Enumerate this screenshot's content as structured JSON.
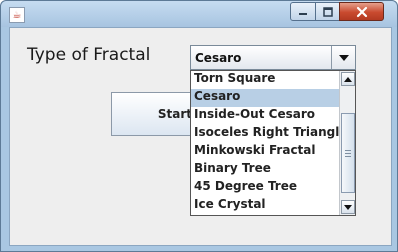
{
  "window": {
    "title": "",
    "icon": "java-icon"
  },
  "titlebar_buttons": {
    "minimize": "minimize-icon",
    "maximize": "maximize-icon",
    "close": "close-icon"
  },
  "form": {
    "type_label": "Type of Fractal",
    "start_label": "Start",
    "combo": {
      "selected": "Cesaro",
      "options": [
        "Torn Square",
        "Cesaro",
        "Inside-Out Cesaro",
        "Isoceles Right Triangle",
        "Minkowski Fractal",
        "Binary Tree",
        "45 Degree Tree",
        "Ice Crystal"
      ],
      "highlighted_index": 1
    }
  },
  "colors": {
    "selection": "#b8cfe5",
    "close_button": "#c94a2f",
    "window_frame": "#a9c7e2"
  }
}
